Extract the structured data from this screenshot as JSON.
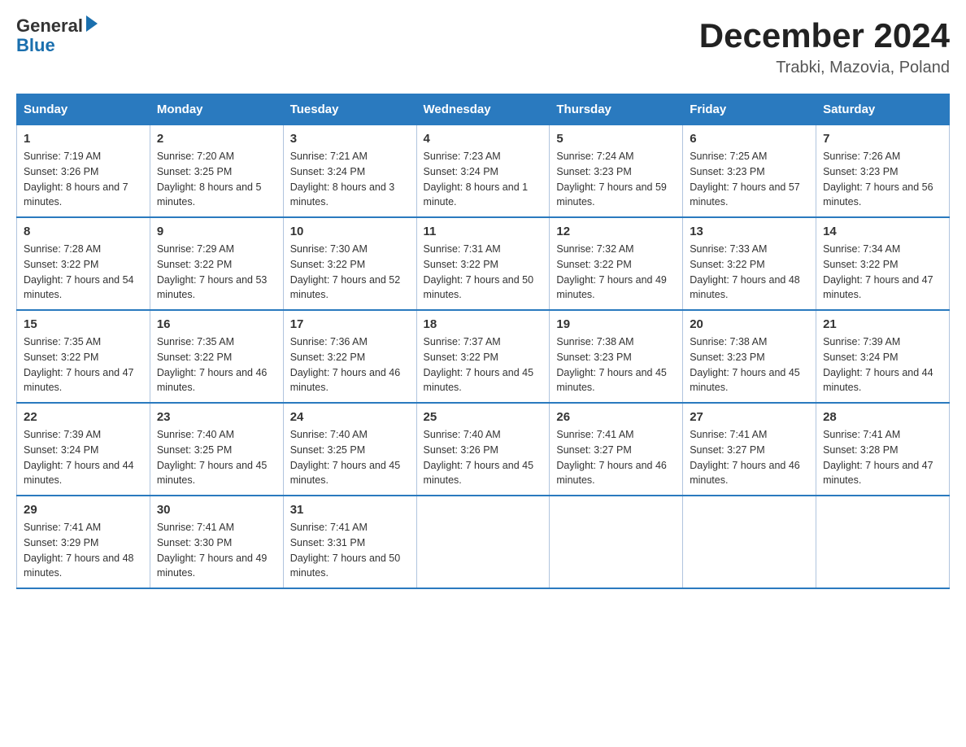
{
  "header": {
    "logo_text_general": "General",
    "logo_text_blue": "Blue",
    "month_year": "December 2024",
    "location": "Trabki, Mazovia, Poland"
  },
  "weekdays": [
    "Sunday",
    "Monday",
    "Tuesday",
    "Wednesday",
    "Thursday",
    "Friday",
    "Saturday"
  ],
  "weeks": [
    [
      {
        "day": "1",
        "sunrise": "7:19 AM",
        "sunset": "3:26 PM",
        "daylight": "8 hours and 7 minutes."
      },
      {
        "day": "2",
        "sunrise": "7:20 AM",
        "sunset": "3:25 PM",
        "daylight": "8 hours and 5 minutes."
      },
      {
        "day": "3",
        "sunrise": "7:21 AM",
        "sunset": "3:24 PM",
        "daylight": "8 hours and 3 minutes."
      },
      {
        "day": "4",
        "sunrise": "7:23 AM",
        "sunset": "3:24 PM",
        "daylight": "8 hours and 1 minute."
      },
      {
        "day": "5",
        "sunrise": "7:24 AM",
        "sunset": "3:23 PM",
        "daylight": "7 hours and 59 minutes."
      },
      {
        "day": "6",
        "sunrise": "7:25 AM",
        "sunset": "3:23 PM",
        "daylight": "7 hours and 57 minutes."
      },
      {
        "day": "7",
        "sunrise": "7:26 AM",
        "sunset": "3:23 PM",
        "daylight": "7 hours and 56 minutes."
      }
    ],
    [
      {
        "day": "8",
        "sunrise": "7:28 AM",
        "sunset": "3:22 PM",
        "daylight": "7 hours and 54 minutes."
      },
      {
        "day": "9",
        "sunrise": "7:29 AM",
        "sunset": "3:22 PM",
        "daylight": "7 hours and 53 minutes."
      },
      {
        "day": "10",
        "sunrise": "7:30 AM",
        "sunset": "3:22 PM",
        "daylight": "7 hours and 52 minutes."
      },
      {
        "day": "11",
        "sunrise": "7:31 AM",
        "sunset": "3:22 PM",
        "daylight": "7 hours and 50 minutes."
      },
      {
        "day": "12",
        "sunrise": "7:32 AM",
        "sunset": "3:22 PM",
        "daylight": "7 hours and 49 minutes."
      },
      {
        "day": "13",
        "sunrise": "7:33 AM",
        "sunset": "3:22 PM",
        "daylight": "7 hours and 48 minutes."
      },
      {
        "day": "14",
        "sunrise": "7:34 AM",
        "sunset": "3:22 PM",
        "daylight": "7 hours and 47 minutes."
      }
    ],
    [
      {
        "day": "15",
        "sunrise": "7:35 AM",
        "sunset": "3:22 PM",
        "daylight": "7 hours and 47 minutes."
      },
      {
        "day": "16",
        "sunrise": "7:35 AM",
        "sunset": "3:22 PM",
        "daylight": "7 hours and 46 minutes."
      },
      {
        "day": "17",
        "sunrise": "7:36 AM",
        "sunset": "3:22 PM",
        "daylight": "7 hours and 46 minutes."
      },
      {
        "day": "18",
        "sunrise": "7:37 AM",
        "sunset": "3:22 PM",
        "daylight": "7 hours and 45 minutes."
      },
      {
        "day": "19",
        "sunrise": "7:38 AM",
        "sunset": "3:23 PM",
        "daylight": "7 hours and 45 minutes."
      },
      {
        "day": "20",
        "sunrise": "7:38 AM",
        "sunset": "3:23 PM",
        "daylight": "7 hours and 45 minutes."
      },
      {
        "day": "21",
        "sunrise": "7:39 AM",
        "sunset": "3:24 PM",
        "daylight": "7 hours and 44 minutes."
      }
    ],
    [
      {
        "day": "22",
        "sunrise": "7:39 AM",
        "sunset": "3:24 PM",
        "daylight": "7 hours and 44 minutes."
      },
      {
        "day": "23",
        "sunrise": "7:40 AM",
        "sunset": "3:25 PM",
        "daylight": "7 hours and 45 minutes."
      },
      {
        "day": "24",
        "sunrise": "7:40 AM",
        "sunset": "3:25 PM",
        "daylight": "7 hours and 45 minutes."
      },
      {
        "day": "25",
        "sunrise": "7:40 AM",
        "sunset": "3:26 PM",
        "daylight": "7 hours and 45 minutes."
      },
      {
        "day": "26",
        "sunrise": "7:41 AM",
        "sunset": "3:27 PM",
        "daylight": "7 hours and 46 minutes."
      },
      {
        "day": "27",
        "sunrise": "7:41 AM",
        "sunset": "3:27 PM",
        "daylight": "7 hours and 46 minutes."
      },
      {
        "day": "28",
        "sunrise": "7:41 AM",
        "sunset": "3:28 PM",
        "daylight": "7 hours and 47 minutes."
      }
    ],
    [
      {
        "day": "29",
        "sunrise": "7:41 AM",
        "sunset": "3:29 PM",
        "daylight": "7 hours and 48 minutes."
      },
      {
        "day": "30",
        "sunrise": "7:41 AM",
        "sunset": "3:30 PM",
        "daylight": "7 hours and 49 minutes."
      },
      {
        "day": "31",
        "sunrise": "7:41 AM",
        "sunset": "3:31 PM",
        "daylight": "7 hours and 50 minutes."
      },
      null,
      null,
      null,
      null
    ]
  ]
}
